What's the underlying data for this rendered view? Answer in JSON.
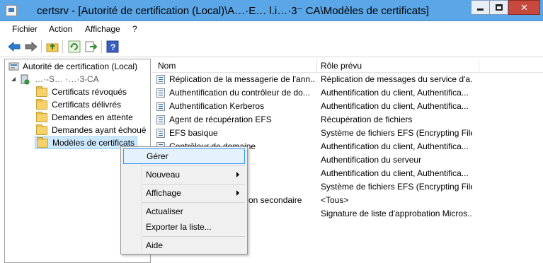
{
  "window": {
    "title": "certsrv - [Autorité de certification (Local)\\A…·E… l.i…·3⁻ CA\\Modèles de certificats]",
    "minimize": "—",
    "maximize": "□",
    "close": "✕"
  },
  "menu": [
    "Fichier",
    "Action",
    "Affichage",
    "?"
  ],
  "toolbar": [
    "back-arrow",
    "forward-arrow",
    "up-folder",
    "refresh",
    "export",
    "help"
  ],
  "tree": {
    "root": "Autorité de certification (Local)",
    "ca": "…·-S… ·…·3-CA",
    "folders": [
      "Certificats révoqués",
      "Certificats délivrés",
      "Demandes en attente",
      "Demandes ayant échoué",
      "Modèles de certificats"
    ]
  },
  "columns": [
    "Nom",
    "Rôle prévu"
  ],
  "rows": [
    {
      "name": "Réplication de la messagerie de l'ann...",
      "role": "Réplication de messages du service d'a..."
    },
    {
      "name": "Authentification du contrôleur de do...",
      "role": "Authentification du client, Authentifica..."
    },
    {
      "name": "Authentification Kerberos",
      "role": "Authentification du client, Authentifica..."
    },
    {
      "name": "Agent de récupération EFS",
      "role": "Récupération de fichiers"
    },
    {
      "name": "EFS basique",
      "role": "Système de fichiers EFS (Encrypting File..."
    },
    {
      "name": "Contrôleur de domaine",
      "role": "Authentification du client, Authentifica..."
    },
    {
      "name": "",
      "role": "Authentification du serveur"
    },
    {
      "name": "",
      "role": "Authentification du client, Authentifica..."
    },
    {
      "name": "",
      "role": "Système de fichiers EFS (Encrypting File..."
    },
    {
      "name": "on secondaire",
      "role": "<Tous>"
    },
    {
      "name": "",
      "role": "Signature de liste d'approbation Micros..."
    }
  ],
  "context_menu": [
    "Gérer",
    "Nouveau",
    "Affichage",
    "Actualiser",
    "Exporter la liste...",
    "Aide"
  ]
}
